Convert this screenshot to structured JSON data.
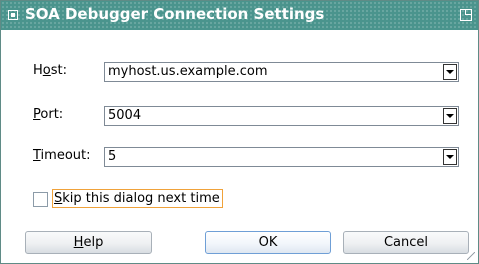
{
  "window": {
    "title": "SOA Debugger Connection Settings"
  },
  "form": {
    "host": {
      "label_mnemonic": "",
      "label_pre": "H",
      "label_u": "o",
      "label_post": "st:",
      "value": "myhost.us.example.com"
    },
    "port": {
      "label_u": "P",
      "label_post": "ort:",
      "value": "5004"
    },
    "timeout": {
      "label_u": "T",
      "label_post": "imeout:",
      "value": "5"
    }
  },
  "skip": {
    "checked": false,
    "label_u": "S",
    "label_post": "kip this dialog next time"
  },
  "buttons": {
    "help_u": "H",
    "help_post": "elp",
    "ok": "OK",
    "cancel": "Cancel"
  },
  "colors": {
    "titlebar": "#4a948d",
    "focus_outline": "#f0a23a",
    "default_button_border": "#6f9fd6"
  }
}
